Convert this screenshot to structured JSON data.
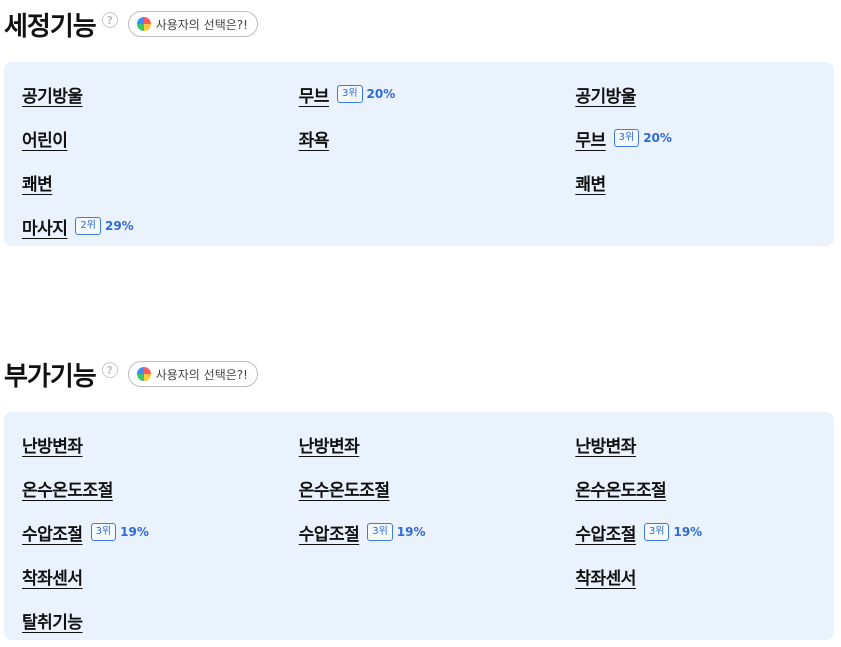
{
  "wash": {
    "title": "세정기능",
    "choice_label": "사용자의 선택은?!",
    "columns": [
      [
        {
          "label": "공기방울"
        },
        {
          "label": "어린이"
        },
        {
          "label": "쾌변"
        },
        {
          "label": "마사지",
          "rank": "2위",
          "pct": "29%"
        }
      ],
      [
        {
          "label": "무브",
          "rank": "3위",
          "pct": "20%"
        },
        {
          "label": "좌욕"
        }
      ],
      [
        {
          "label": "공기방울"
        },
        {
          "label": "무브",
          "rank": "3위",
          "pct": "20%"
        },
        {
          "label": "쾌변"
        }
      ]
    ]
  },
  "extra": {
    "title": "부가기능",
    "choice_label": "사용자의 선택은?!",
    "columns": [
      [
        {
          "label": "난방변좌"
        },
        {
          "label": "온수온도조절"
        },
        {
          "label": "수압조절",
          "rank": "3위",
          "pct": "19%"
        },
        {
          "label": "착좌센서"
        },
        {
          "label": "탈취기능"
        }
      ],
      [
        {
          "label": "난방변좌"
        },
        {
          "label": "온수온도조절"
        },
        {
          "label": "수압조절",
          "rank": "3위",
          "pct": "19%"
        }
      ],
      [
        {
          "label": "난방변좌"
        },
        {
          "label": "온수온도조절"
        },
        {
          "label": "수압조절",
          "rank": "3위",
          "pct": "19%"
        },
        {
          "label": "착좌센서"
        }
      ]
    ]
  },
  "icons": {
    "help": "question-circle-icon",
    "choice": "pie-chart-icon"
  },
  "colors": {
    "panel_bg": "#eaf2fd",
    "accent": "#2f6bd8"
  }
}
